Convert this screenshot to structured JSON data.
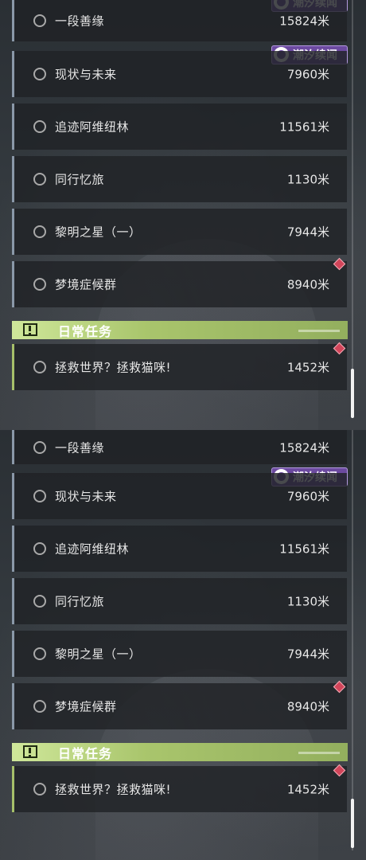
{
  "tag_label": "潮汐续闻",
  "daily_section_title": "日常任务",
  "quests": [
    {
      "name": "一段善缘",
      "distance": "15824米"
    },
    {
      "name": "现状与未来",
      "distance": "7960米"
    },
    {
      "name": "追迹阿维纽林",
      "distance": "11561米"
    },
    {
      "name": "同行忆旅",
      "distance": "1130米"
    },
    {
      "name": "黎明之星（一）",
      "distance": "7944米"
    },
    {
      "name": "梦境症候群",
      "distance": "8940米"
    }
  ],
  "daily_quest": {
    "name": "拯救世界？拯救猫咪!",
    "distance": "1452米"
  },
  "colors": {
    "quest_accent": "#8a98a8",
    "daily_accent": "#a6c06a",
    "tag_purple": "#6c4aa0",
    "marker_red": "#d2455a"
  }
}
